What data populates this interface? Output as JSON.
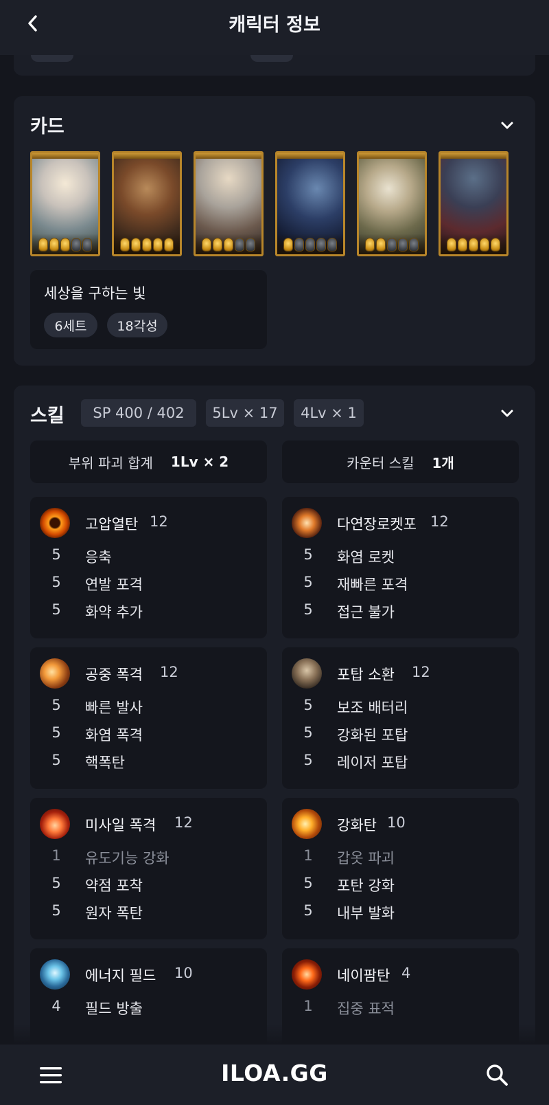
{
  "header": {
    "title": "캐릭터 정보"
  },
  "cards_section": {
    "title": "카드",
    "cards": [
      {
        "gems_on": 3,
        "gems_total": 5,
        "palette": "angel"
      },
      {
        "gems_on": 5,
        "gems_total": 5,
        "palette": "warrior"
      },
      {
        "gems_on": 3,
        "gems_total": 5,
        "palette": "knight"
      },
      {
        "gems_on": 1,
        "gems_total": 5,
        "palette": "dark"
      },
      {
        "gems_on": 2,
        "gems_total": 5,
        "palette": "elf"
      },
      {
        "gems_on": 5,
        "gems_total": 5,
        "palette": "wanderer"
      }
    ],
    "set_name": "세상을 구하는 빛",
    "set_tags": [
      "6세트",
      "18각성"
    ]
  },
  "skills_section": {
    "title": "스킬",
    "badges": [
      "SP 400 / 402",
      "5Lv × 17",
      "4Lv × 1"
    ],
    "part_break": {
      "label": "부위 파괴 합계",
      "value": "1Lv × 2"
    },
    "counter": {
      "label": "카운터 스킬",
      "value": "1개"
    },
    "skills": [
      {
        "name": "고압열탄",
        "level": "12",
        "icon": "fire-ring",
        "tripods": [
          {
            "level": "5",
            "name": "응축"
          },
          {
            "level": "5",
            "name": "연발 포격"
          },
          {
            "level": "5",
            "name": "화약 추가"
          }
        ]
      },
      {
        "name": "다연장로켓포",
        "level": "12",
        "icon": "rocket-burst",
        "tripods": [
          {
            "level": "5",
            "name": "화염 로켓"
          },
          {
            "level": "5",
            "name": "재빠른 포격"
          },
          {
            "level": "5",
            "name": "접근 불가"
          }
        ]
      },
      {
        "name": "공중 폭격",
        "level": "12",
        "icon": "air-strike",
        "tripods": [
          {
            "level": "5",
            "name": "빠른 발사"
          },
          {
            "level": "5",
            "name": "화염 폭격"
          },
          {
            "level": "5",
            "name": "핵폭탄"
          }
        ]
      },
      {
        "name": "포탑 소환",
        "level": "12",
        "icon": "turret",
        "tripods": [
          {
            "level": "5",
            "name": "보조 배터리"
          },
          {
            "level": "5",
            "name": "강화된 포탑"
          },
          {
            "level": "5",
            "name": "레이저 포탑"
          }
        ]
      },
      {
        "name": "미사일 폭격",
        "level": "12",
        "icon": "missile",
        "tripods": [
          {
            "level": "1",
            "name": "유도기능 강화",
            "dim": true
          },
          {
            "level": "5",
            "name": "약점 포착"
          },
          {
            "level": "5",
            "name": "원자 폭탄"
          }
        ]
      },
      {
        "name": "강화탄",
        "level": "10",
        "icon": "enhanced-shell",
        "tripods": [
          {
            "level": "1",
            "name": "갑옷 파괴",
            "dim": true
          },
          {
            "level": "5",
            "name": "포탄 강화"
          },
          {
            "level": "5",
            "name": "내부 발화"
          }
        ]
      },
      {
        "name": "에너지 필드",
        "level": "10",
        "icon": "energy-field",
        "tripods": [
          {
            "level": "4",
            "name": "필드 방출"
          }
        ]
      },
      {
        "name": "네이팜탄",
        "level": "4",
        "icon": "napalm",
        "tripods": [
          {
            "level": "1",
            "name": "집중 표적",
            "dim": true
          }
        ]
      }
    ]
  },
  "footer": {
    "logo": "ILOA.GG"
  },
  "colors": {
    "background": "#14161d",
    "panel": "#1b1e27",
    "inner": "#14161d",
    "badge": "#2a2e3a",
    "card_frame": "#b8862a",
    "gem_on": "#e3a623"
  }
}
